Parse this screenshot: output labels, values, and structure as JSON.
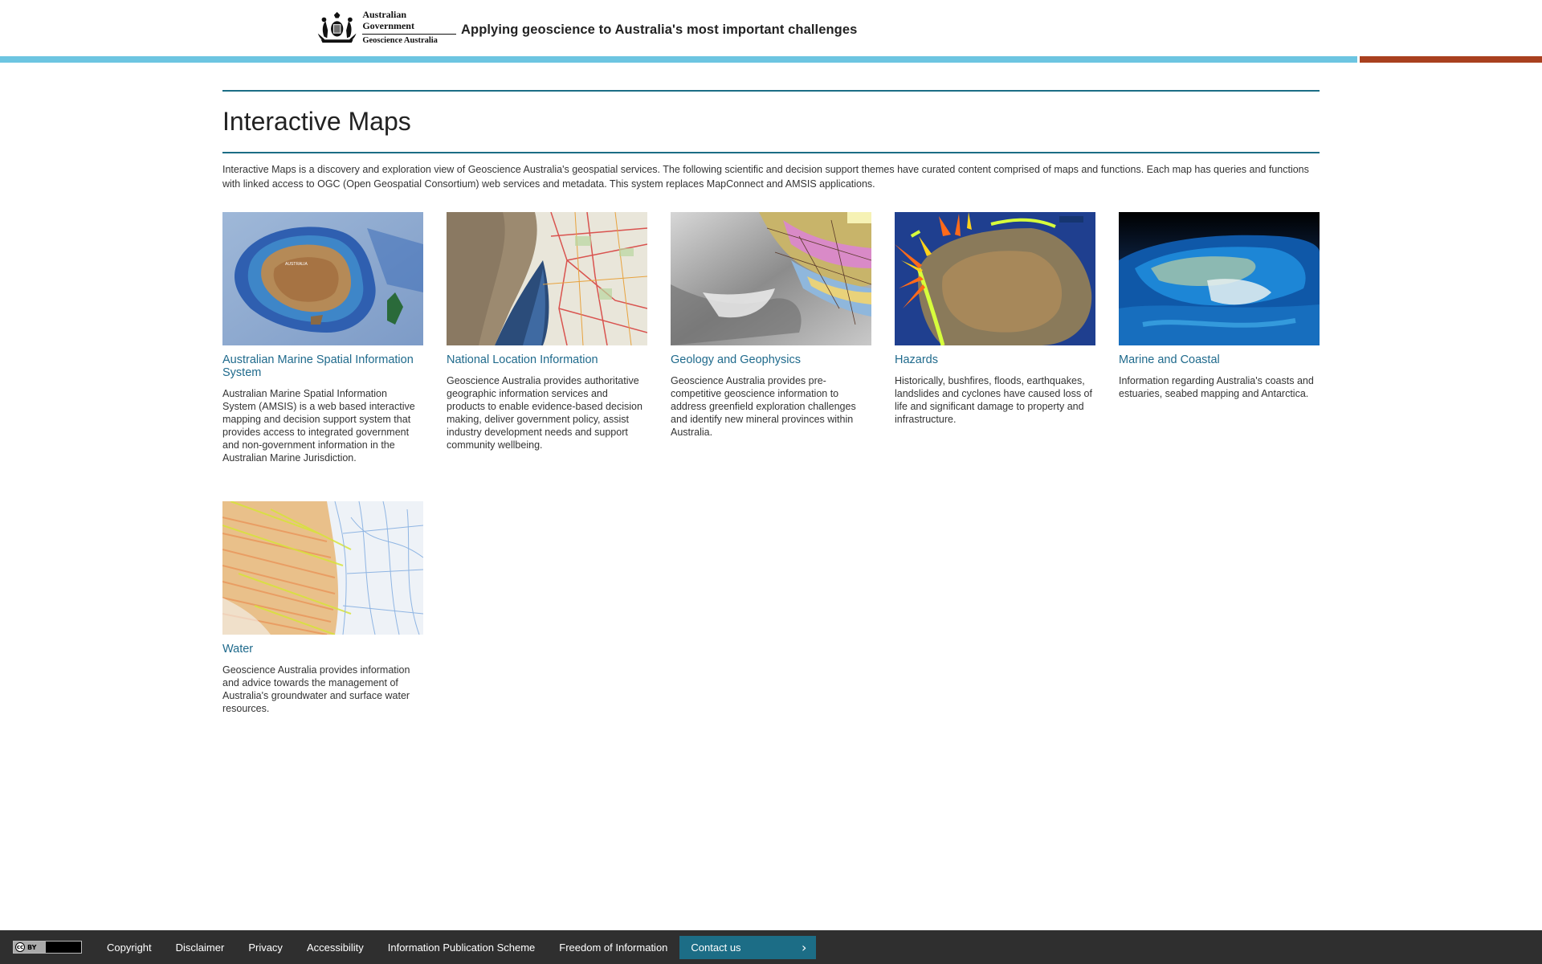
{
  "header": {
    "logo": {
      "gov": "Australian Government",
      "agency": "Geoscience Australia"
    },
    "tagline": "Applying geoscience to Australia's most important challenges"
  },
  "page": {
    "title": "Interactive Maps",
    "intro": "Interactive Maps is a discovery and exploration view of Geoscience Australia's geospatial services. The following scientific and decision support themes have curated content comprised of maps and functions. Each map has queries and functions with linked access to OGC (Open Geospatial Consortium) web services and metadata. This system replaces MapConnect and AMSIS applications."
  },
  "maps": [
    {
      "title": "Australian Marine Spatial Information System",
      "description": "Australian Marine Spatial Information System (AMSIS) is a web based interactive mapping and decision support system that provides access to integrated government and non-government information in the Australian Marine Jurisdiction.",
      "thumb_label": "AUSTRALIA"
    },
    {
      "title": "National Location Information",
      "description": "Geoscience Australia provides authoritative geographic information services and products to enable evidence-based decision making, deliver government policy, assist industry development needs and support community wellbeing."
    },
    {
      "title": "Geology and Geophysics",
      "description": "Geoscience Australia provides pre-competitive geoscience information to address greenfield exploration challenges and identify new mineral provinces within Australia."
    },
    {
      "title": "Hazards",
      "description": "Historically, bushfires, floods, earthquakes, landslides and cyclones have caused loss of life and significant damage to property and infrastructure."
    },
    {
      "title": "Marine and Coastal",
      "description": "Information regarding Australia's coasts and estuaries, seabed mapping and Antarctica."
    },
    {
      "title": "Water",
      "description": "Geoscience Australia provides information and advice towards the management of Australia's groundwater and surface water resources."
    }
  ],
  "footer": {
    "license": "BY",
    "links": [
      "Copyright",
      "Disclaimer",
      "Privacy",
      "Accessibility",
      "Information Publication Scheme",
      "Freedom of Information"
    ],
    "contact": "Contact us"
  }
}
